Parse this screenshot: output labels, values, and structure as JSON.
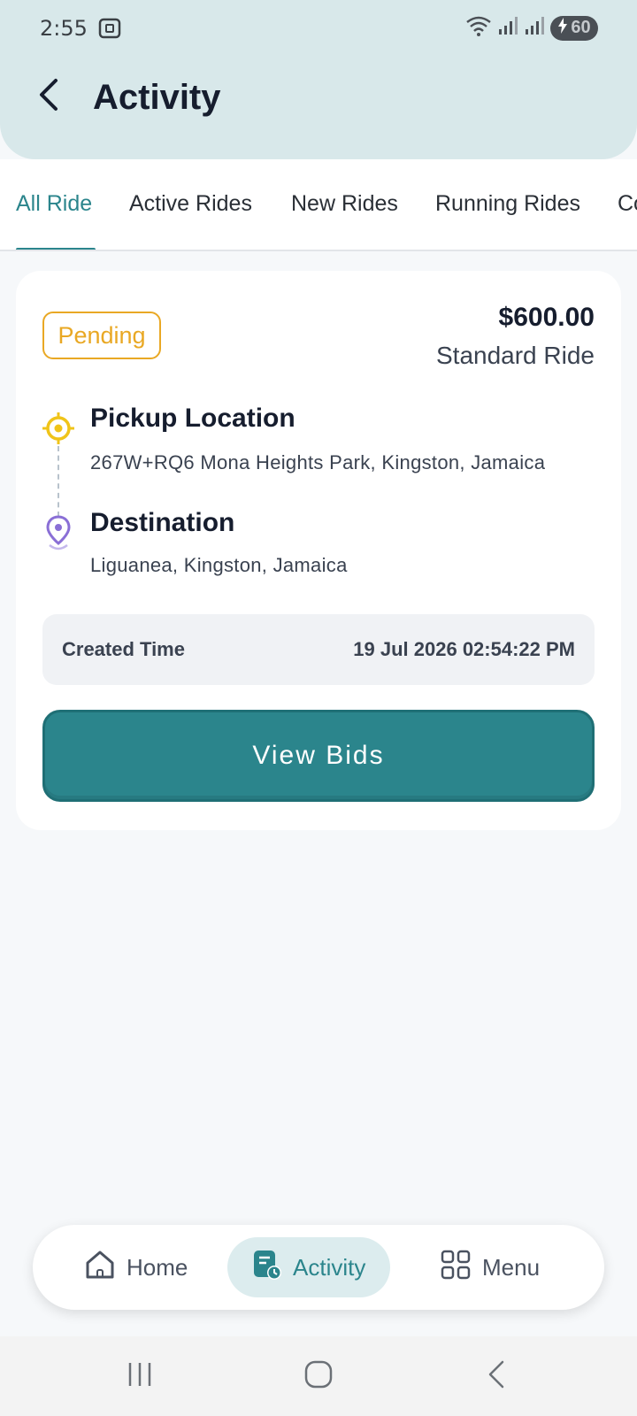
{
  "status_bar": {
    "time": "2:55",
    "battery_level": "60",
    "icons": [
      "screenshot-icon",
      "wifi-icon",
      "signal-icon",
      "signal-icon",
      "battery-charging-icon"
    ]
  },
  "header": {
    "title": "Activity",
    "back_icon": "chevron-left-icon"
  },
  "tabs": [
    {
      "label": "All Ride",
      "active": true
    },
    {
      "label": "Active Rides",
      "active": false
    },
    {
      "label": "New Rides",
      "active": false
    },
    {
      "label": "Running Rides",
      "active": false
    },
    {
      "label": "Co",
      "active": false
    }
  ],
  "ride": {
    "status": "Pending",
    "price": "$600.00",
    "ride_type": "Standard Ride",
    "pickup_title": "Pickup Location",
    "pickup_address": "267W+RQ6 Mona Heights Park, Kingston, Jamaica",
    "destination_title": "Destination",
    "destination_address": "Liguanea, Kingston, Jamaica",
    "created_label": "Created Time",
    "created_value": "19 Jul 2026 02:54:22 PM",
    "action_label": "View Bids"
  },
  "bottom_nav": [
    {
      "label": "Home",
      "icon": "home-icon",
      "active": false
    },
    {
      "label": "Activity",
      "icon": "activity-icon",
      "active": true
    },
    {
      "label": "Menu",
      "icon": "grid-menu-icon",
      "active": false
    }
  ],
  "colors": {
    "accent": "#2b858c",
    "header_bg": "#d8e8ea",
    "pending": "#e9a824",
    "pickup": "#f0c419",
    "destination": "#8a6fd6"
  }
}
